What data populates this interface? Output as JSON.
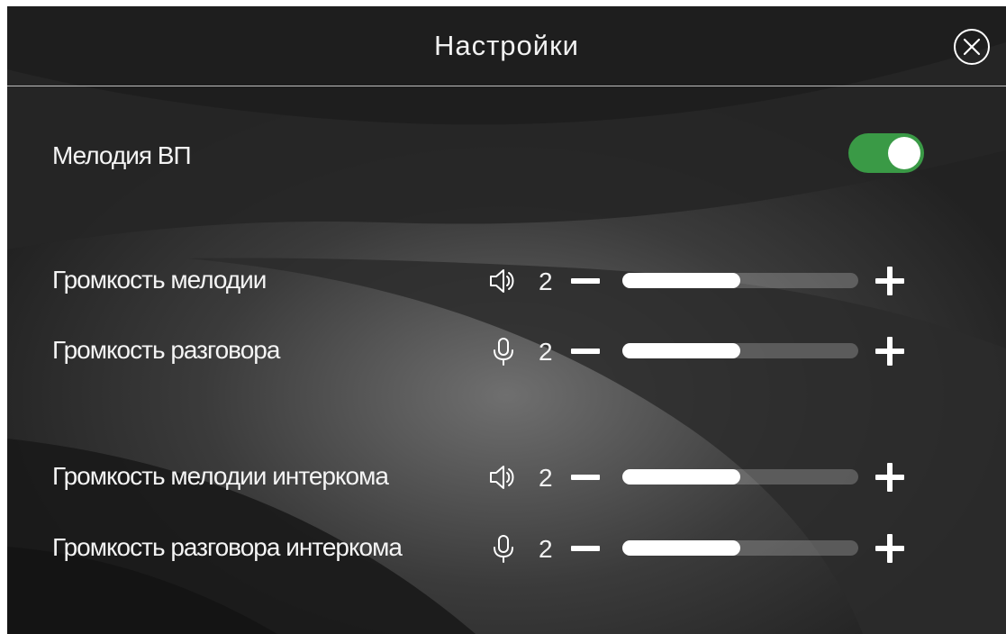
{
  "header": {
    "title": "Настройки",
    "close_icon": "close-circle-icon"
  },
  "ringtone": {
    "label": "Мелодия ВП",
    "enabled": true,
    "accent": "#3a9a46"
  },
  "volume_rows": [
    {
      "label": "Громкость мелодии",
      "icon": "speaker-icon",
      "value": "2",
      "level": 0.5
    },
    {
      "label": "Громкость разговора",
      "icon": "microphone-icon",
      "value": "2",
      "level": 0.5
    },
    {
      "label": "Громкость мелодии интеркома",
      "icon": "speaker-icon",
      "value": "2",
      "level": 0.5
    },
    {
      "label": "Громкость разговора интеркома",
      "icon": "microphone-icon",
      "value": "2",
      "level": 0.5
    }
  ]
}
